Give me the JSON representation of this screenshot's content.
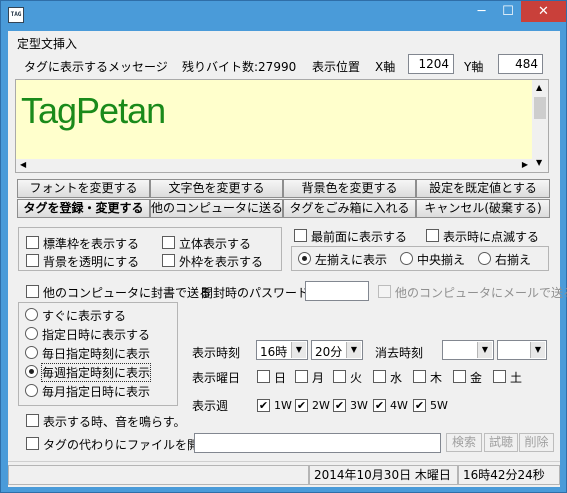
{
  "window": {
    "app_icon_text": "TAG",
    "minimize_glyph": "─",
    "maximize_glyph": "☐",
    "close_glyph": "✕"
  },
  "dialog_title": "定型文挿入",
  "message": {
    "label": "タグに表示するメッセージ",
    "remaining_label": "残りバイト数:27990",
    "position_label": "表示位置",
    "x_label": "X軸",
    "x_value": "1204",
    "y_label": "Y軸",
    "y_value": "484",
    "text": "TagPetan",
    "text_color": "#1a8a1a",
    "bg_color": "#ffffcc"
  },
  "buttons": {
    "font": "フォントを変更する",
    "text_color": "文字色を変更する",
    "bg_color": "背景色を変更する",
    "defaults": "設定を既定値とする",
    "register": "タグを登録・変更する",
    "send": "他のコンピュータに送る",
    "trash": "タグをごみ箱に入れる",
    "cancel": "キャンセル(破棄する)",
    "search": "検索",
    "preview": "試聴",
    "delete": "削除"
  },
  "style_options": {
    "standard_frame": "標準枠を表示する",
    "solid": "立体表示する",
    "transparent_bg": "背景を透明にする",
    "outer_frame": "外枠を表示する"
  },
  "topmost": "最前面に表示する",
  "blink": "表示時に点滅する",
  "align": {
    "left": "左揃えに表示",
    "center": "中央揃え",
    "right": "右揃え",
    "selected": "left"
  },
  "seal": {
    "label": "他のコンピュータに封書で送る",
    "password_label": "開封時のパスワード",
    "mail": "他のコンピュータにメールで送る"
  },
  "timing": {
    "options": [
      "すぐに表示する",
      "指定日時に表示する",
      "毎日指定時刻に表示",
      "毎週指定時刻に表示",
      "毎月指定日時に表示"
    ],
    "selected": 3
  },
  "show_time": {
    "label": "表示時刻",
    "hour": "16時",
    "minute": "20分"
  },
  "erase_time": {
    "label": "消去時刻",
    "hour": "",
    "minute": ""
  },
  "weekday": {
    "label": "表示曜日",
    "days": [
      "日",
      "月",
      "火",
      "水",
      "木",
      "金",
      "土"
    ]
  },
  "week": {
    "label": "表示週",
    "weeks": [
      "1W",
      "2W",
      "3W",
      "4W",
      "5W"
    ]
  },
  "sound": "表示する時、音を鳴らす。",
  "open_file": "タグの代わりにファイルを開く。",
  "status": {
    "date": "2014年10月30日 木曜日",
    "time": "16時42分24秒"
  }
}
